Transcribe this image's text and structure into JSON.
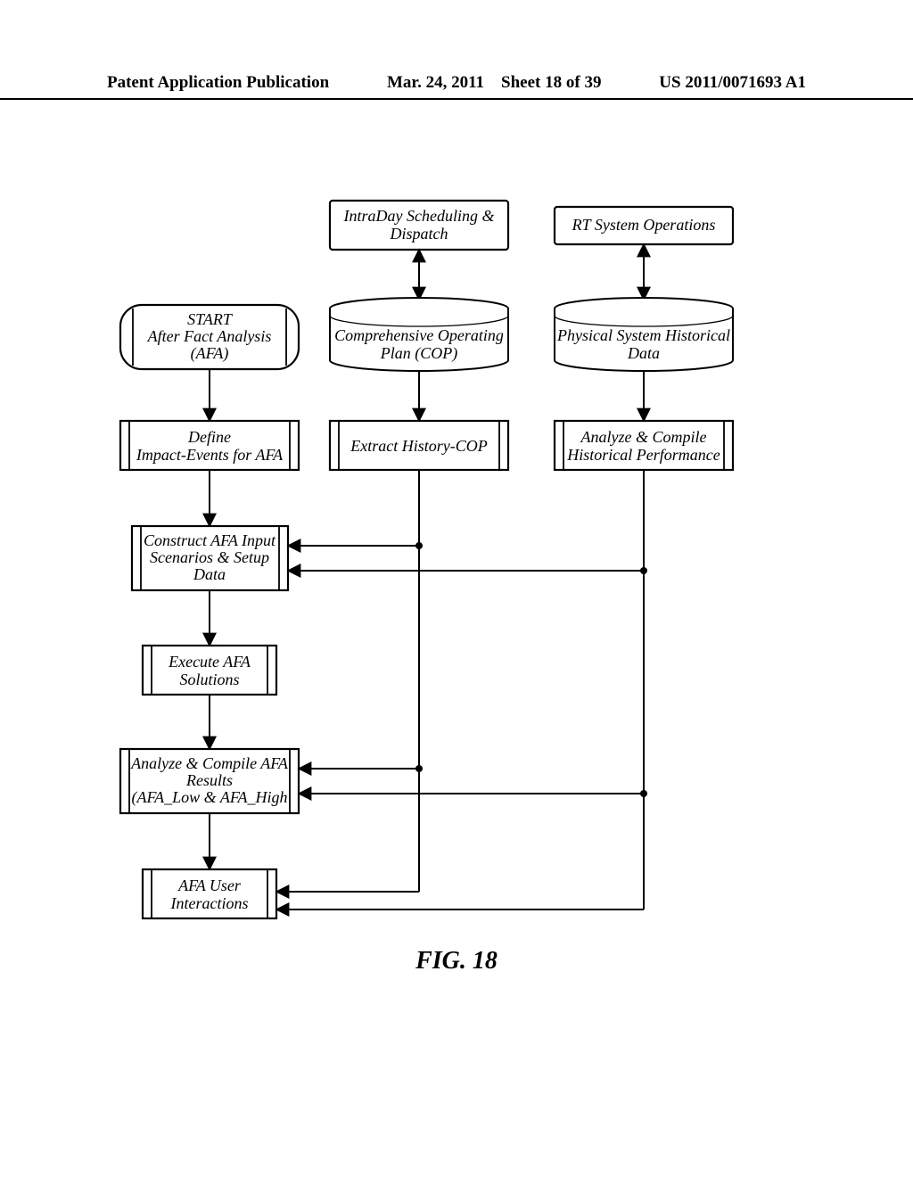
{
  "header": {
    "pub": "Patent Application Publication",
    "date": "Mar. 24, 2011",
    "sheet": "Sheet 18 of 39",
    "docnum": "US 2011/0071693 A1"
  },
  "nodes": {
    "intraday": "IntraDay Scheduling &\nDispatch",
    "rtops": "RT System Operations",
    "start": "START\nAfter Fact Analysis\n(AFA)",
    "cop": "Comprehensive Operating\nPlan (COP)",
    "hist": "Physical System Historical\nData",
    "define": "Define\nImpact-Events for AFA",
    "extract": "Extract History-COP",
    "analyze_hist": "Analyze & Compile\nHistorical Performance",
    "construct": "Construct AFA Input\nScenarios & Setup\nData",
    "execute": "Execute AFA\nSolutions",
    "results": "Analyze & Compile AFA\nResults\n(AFA_Low & AFA_High",
    "interactions": "AFA User\nInteractions"
  },
  "caption": "FIG. 18"
}
